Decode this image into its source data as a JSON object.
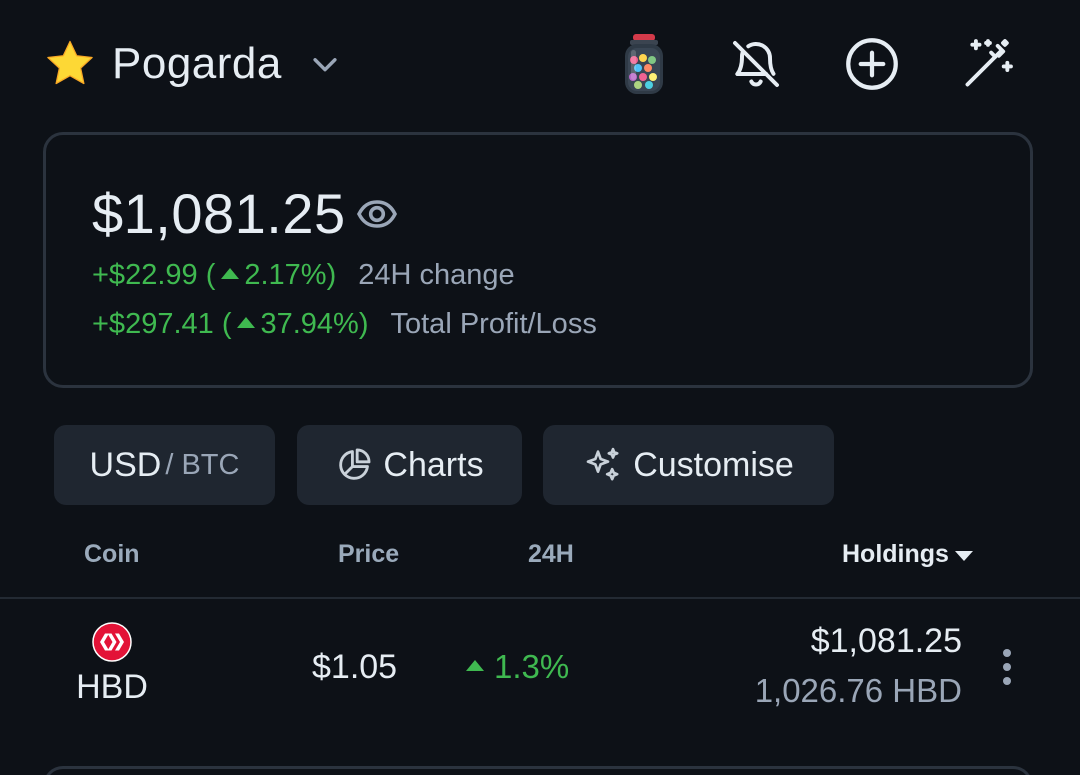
{
  "header": {
    "portfolio_name": "Pogarda",
    "icons": [
      "star-icon",
      "chevron-down-icon",
      "candy-jar-icon",
      "bell-off-icon",
      "add-circle-icon",
      "magic-wand-icon"
    ]
  },
  "summary": {
    "balance": "$1,081.25",
    "change_24h": {
      "amount": "+$22.99 (",
      "percent": "2.17%)",
      "label": "24H change"
    },
    "total_pl": {
      "amount": "+$297.41 (",
      "percent": "37.94%)",
      "label": "Total Profit/Loss"
    }
  },
  "toolbar": {
    "currency_primary": "USD",
    "currency_secondary": "/ BTC",
    "charts_label": "Charts",
    "customise_label": "Customise"
  },
  "table": {
    "headers": {
      "coin": "Coin",
      "price": "Price",
      "change": "24H",
      "holdings": "Holdings"
    },
    "rows": [
      {
        "symbol": "HBD",
        "price": "$1.05",
        "change_24h": "1.3%",
        "holdings_value": "$1,081.25",
        "holdings_qty": "1,026.76 HBD"
      }
    ]
  },
  "colors": {
    "background": "#0d1117",
    "positive": "#3fb950",
    "muted": "#9aa6b7",
    "card_border": "#2b333e",
    "button_bg": "#1f2630",
    "hive_red": "#e31337"
  }
}
